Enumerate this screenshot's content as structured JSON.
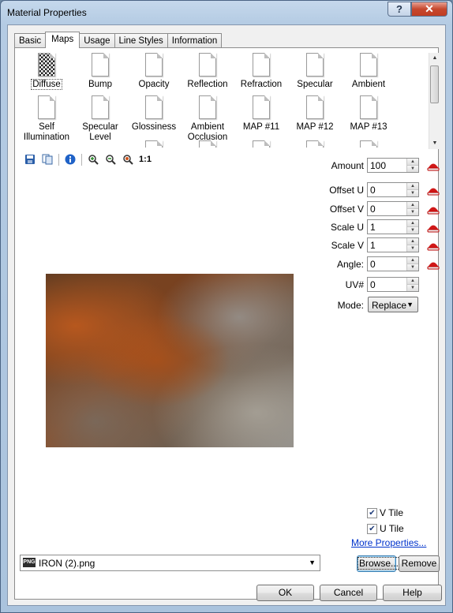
{
  "window": {
    "title": "Material Properties",
    "help_caption": "?",
    "close_caption": "✕"
  },
  "tabs": [
    {
      "label": "Basic"
    },
    {
      "label": "Maps"
    },
    {
      "label": "Usage"
    },
    {
      "label": "Line Styles"
    },
    {
      "label": "Information"
    }
  ],
  "maps": {
    "row1": [
      "Diffuse",
      "Bump",
      "Opacity",
      "Reflection",
      "Refraction",
      "Specular",
      "Ambient"
    ],
    "row2": [
      "Self Illumination",
      "Specular Level",
      "Glossiness",
      "Ambient Occlusion",
      "MAP #11",
      "MAP #12",
      "MAP #13"
    ],
    "selected": "Diffuse"
  },
  "toolbar": {
    "icons": [
      "save-icon",
      "copy-icon",
      "info-icon",
      "zoom-in-icon",
      "zoom-out-icon",
      "zoom-fit-icon"
    ],
    "actual_size_label": "1:1"
  },
  "properties": {
    "amount": {
      "label": "Amount",
      "value": "100"
    },
    "offset_u": {
      "label": "Offset U",
      "value": "0"
    },
    "offset_v": {
      "label": "Offset V",
      "value": "0"
    },
    "scale_u": {
      "label": "Scale U",
      "value": "1"
    },
    "scale_v": {
      "label": "Scale V",
      "value": "1"
    },
    "angle": {
      "label": "Angle:",
      "value": "0"
    },
    "uv": {
      "label": "UV#",
      "value": "0"
    },
    "mode": {
      "label": "Mode:",
      "value": "Replace"
    }
  },
  "tiling": {
    "v_tile": {
      "label": "V Tile",
      "checked": true
    },
    "u_tile": {
      "label": "U Tile",
      "checked": true
    }
  },
  "more_properties_link": "More Properties...",
  "file": {
    "name": "IRON (2).png",
    "type_badge": "PNG"
  },
  "file_buttons": {
    "browse": "Browse...",
    "remove": "Remove"
  },
  "dialog_buttons": {
    "ok": "OK",
    "cancel": "Cancel",
    "help": "Help"
  },
  "colors": {
    "accent_red": "#d01818",
    "link": "#0033cc"
  }
}
